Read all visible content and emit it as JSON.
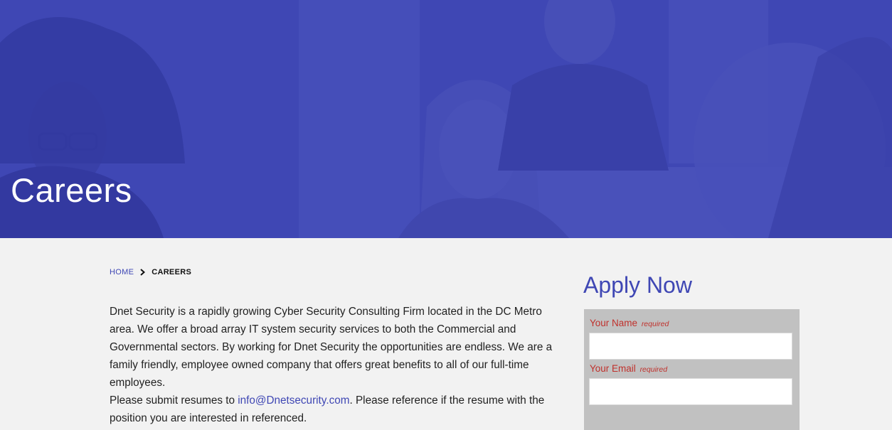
{
  "hero": {
    "title": "Careers"
  },
  "breadcrumb": {
    "home": "HOME",
    "current": "CAREERS"
  },
  "content": {
    "paragraph1": "Dnet Security is a rapidly growing Cyber Security Consulting Firm located in the DC Metro area. We offer a broad array IT system security services to both the Commercial and Governmental sectors. By working for Dnet Security the opportunities are endless. We are a family friendly, employee owned company that offers great benefits to all of our full-time employees.",
    "paragraph2_before": "Please submit resumes to ",
    "email": "info@Dnetsecurity.com",
    "paragraph2_after": ". Please reference if the resume with the position you are interested in referenced."
  },
  "form": {
    "title": "Apply Now",
    "name_label": "Your Name",
    "email_label": "Your Email",
    "required_text": "required",
    "name_value": "",
    "email_value": ""
  },
  "colors": {
    "brand": "#3f47b4",
    "required_label": "#c0312c"
  }
}
